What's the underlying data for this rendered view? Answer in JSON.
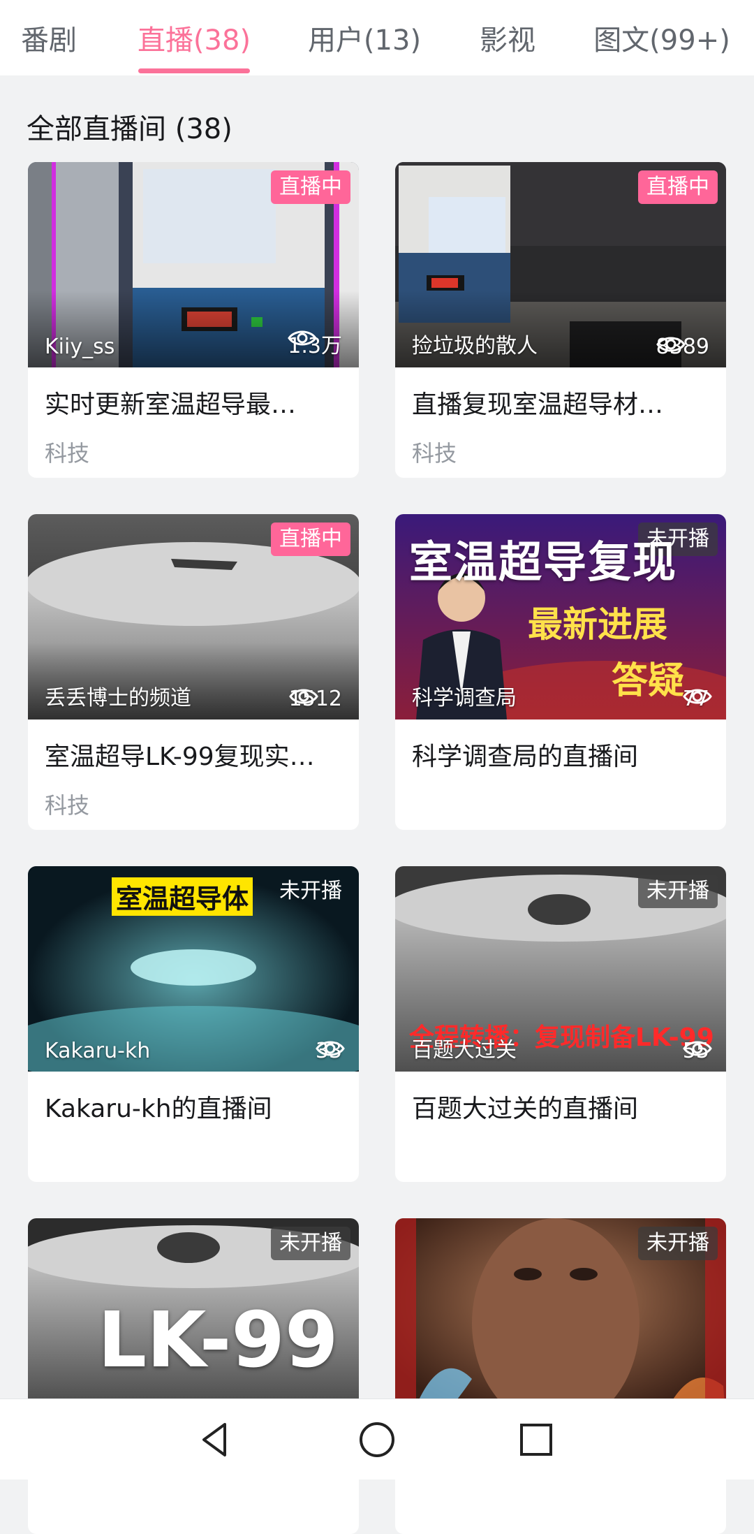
{
  "tabs": [
    {
      "label": "番剧",
      "active": false
    },
    {
      "label": "直播(38)",
      "active": true
    },
    {
      "label": "用户(13)",
      "active": false
    },
    {
      "label": "影视",
      "active": false
    },
    {
      "label": "图文(99+)",
      "active": false
    }
  ],
  "section_title": "全部直播间 (38)",
  "cards": [
    {
      "uploader": "Kiiy_ss",
      "views": "1.3万",
      "status": "直播中",
      "title": "实时更新室温超导最…",
      "category": "科技"
    },
    {
      "uploader": "捡垃圾的散人",
      "views": "8389",
      "status": "直播中",
      "title": "直播复现室温超导材…",
      "category": "科技"
    },
    {
      "uploader": "丢丢博士的频道",
      "views": "1512",
      "status": "直播中",
      "title": "室温超导LK-99复现实…",
      "category": "科技"
    },
    {
      "uploader": "科学调查局",
      "views": "77",
      "status": "未开播",
      "title": "科学调查局的直播间",
      "category": "",
      "thumb_text": [
        "室温超导复现",
        "最新进展",
        "答疑"
      ]
    },
    {
      "uploader": "Kakaru-kh",
      "views": "33",
      "status": "未开播",
      "title": "Kakaru-kh的直播间",
      "category": "",
      "thumb_text": [
        "室温超导体"
      ]
    },
    {
      "uploader": "百题大过关",
      "views": "55",
      "status": "未开播",
      "title": "百题大过关的直播间",
      "category": "",
      "thumb_text": [
        "全程转播：复现制备LK-99"
      ]
    },
    {
      "uploader": "",
      "views": "",
      "status": "未开播",
      "title": "",
      "category": "",
      "thumb_text": [
        "LK-99"
      ]
    },
    {
      "uploader": "",
      "views": "",
      "status": "未开播",
      "title": "",
      "category": ""
    }
  ],
  "colors": {
    "accent": "#fb7299",
    "live_badge": "#ff6699",
    "background": "#f1f2f3"
  },
  "nav": [
    "back-icon",
    "home-icon",
    "recents-icon"
  ]
}
